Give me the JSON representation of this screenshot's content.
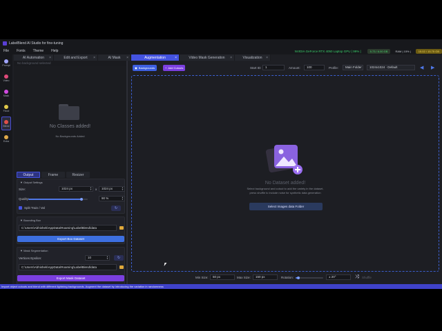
{
  "window": {
    "title": "LabelBlend AI Studio for fine-tuning"
  },
  "menu": [
    "File",
    "Fonts",
    "Theme",
    "Help"
  ],
  "status": {
    "gpu": "NVIDIA GeForce RTX 4050 Laptop GPU | 99% |",
    "vram": "5.73 / 6.00 GB",
    "ram": "RAM | 15% |",
    "disk": "15.02 / 15.75 GB"
  },
  "sidebar": [
    {
      "label": "Prompt",
      "icon": "prompt-icon",
      "color": "#a0a4ff"
    },
    {
      "label": "Video",
      "icon": "video-icon",
      "color": "#e04a7a"
    },
    {
      "label": "Mask",
      "icon": "mask-icon",
      "color": "#d04ae0"
    },
    {
      "label": "Flood",
      "icon": "flood-icon",
      "color": "#e0c94a"
    },
    {
      "label": "Blend",
      "icon": "blend-icon",
      "color": "#e0504a"
    },
    {
      "label": "Extra",
      "icon": "extra-icon",
      "color": "#e0a94a"
    }
  ],
  "tabs": [
    {
      "label": "AI Automation",
      "active": false
    },
    {
      "label": "Edit and Export",
      "active": false
    },
    {
      "label": "AI Mask",
      "active": false
    },
    {
      "label": "Augmentation",
      "active": true
    },
    {
      "label": "Video Mask Generation",
      "active": false
    },
    {
      "label": "Visualization",
      "active": false
    }
  ],
  "left": {
    "header": "No background selected",
    "empty_title": "No Classes added!",
    "empty_sub": "No Backgrounds Added",
    "subtabs": [
      "Output",
      "Frame",
      "Resizer"
    ],
    "output_settings": {
      "title": "▼ Output Settings",
      "size_label": "Size:",
      "width": "1024 px",
      "x": "x",
      "height": "1024 px",
      "quality_label": "Quality:",
      "quality": "90 %",
      "quality_value": 0.9,
      "split_label": "Split Train / Val"
    },
    "bbox": {
      "title": "▼ Bounding Box",
      "path": "C:\\Users\\Abhishek\\AppData\\Roaming\\LabelBlend\\data",
      "export_label": "Export Box Dataset"
    },
    "mask": {
      "title": "▼ Mask Segmentation",
      "vertices_label": "Vertices Epsilon:",
      "vertices": "10",
      "path": "C:\\Users\\Abhishek\\AppData\\Roaming\\LabelBlend\\data",
      "export_label": "Export Mask Dataset"
    }
  },
  "toolbar": {
    "backgrounds": "Backgrounds",
    "add_cutouts": "Add Cutouts",
    "start_id_label": "Start ID:",
    "start_id": "1",
    "amount_label": "Amount:",
    "amount": "100",
    "profile_label": "Profile:",
    "profile_folder": "Main Folder",
    "profile": "1024x1024 · Default"
  },
  "canvas": {
    "title": "No Dataset added!",
    "desc": "Select background and cutout to add the variety in the dataset, press shuffle to include noise for synthetic data generation",
    "button": "Select Images data Folder"
  },
  "bottom": {
    "min_label": "Min Size:",
    "min": "50 px",
    "max_label": "Max Size:",
    "max": "150 px",
    "rot_label": "Rotation:",
    "rot": "± 20°",
    "shuffle": "Shuffle"
  },
  "statusbar": "Import object cutouts and blend with different lightning backgrounds. Augment the dataset by introducing the variation in randomness"
}
